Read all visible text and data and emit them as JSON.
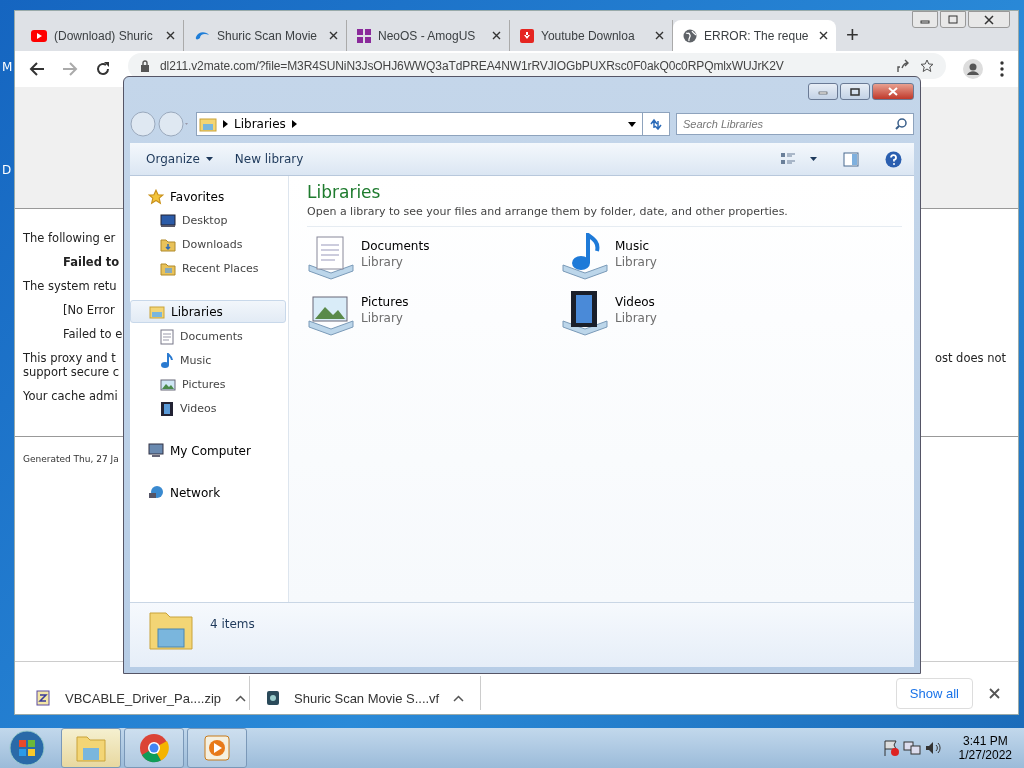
{
  "desktop": {
    "labels": [
      "M",
      "D"
    ]
  },
  "browser": {
    "tabs": [
      {
        "label": "(Download) Shuric",
        "selected": false
      },
      {
        "label": "Shuric Scan Movie",
        "selected": false
      },
      {
        "label": "NeoOS - AmogUS",
        "selected": false
      },
      {
        "label": "Youtube Downloa",
        "selected": false
      },
      {
        "label": "ERROR: The reque",
        "selected": true
      }
    ],
    "new_tab": "+",
    "address": "dl211.v2mate.com/?file=M3R4SUNiN3JsOHJ6WWQ3aTdPREA4NW1rRVJIOGbPUXRsc0F0akQ0c0RPQmlxWUJrK2V",
    "page": {
      "lines": [
        {
          "text": "The following er",
          "indent": false,
          "bold": false
        },
        {
          "text": "Failed to",
          "indent": true,
          "bold": true
        },
        {
          "text": "The system retu",
          "indent": false,
          "bold": false
        },
        {
          "text": "[No Error",
          "indent": true,
          "bold": false
        },
        {
          "text": "Failed to e",
          "indent": true,
          "bold": false
        },
        {
          "text": "This proxy and t",
          "continuation": "support secure c",
          "indent": false,
          "bold": false,
          "right": "ost does not"
        },
        {
          "text": "Your cache admi",
          "indent": false,
          "bold": false
        }
      ],
      "footer": "Generated Thu, 27 Ja"
    },
    "downloads": [
      {
        "name": "VBCABLE_Driver_Pa....zip"
      },
      {
        "name": "Shuric Scan Movie S....vf"
      }
    ],
    "show_all": "Show all"
  },
  "explorer": {
    "breadcrumb": "Libraries",
    "search_placeholder": "Search Libraries",
    "commands": [
      "Organize",
      "New library"
    ],
    "nav": [
      {
        "label": "Favorites",
        "selected": false,
        "children": [
          {
            "label": "Desktop",
            "selected": false
          },
          {
            "label": "Downloads",
            "selected": false
          },
          {
            "label": "Recent Places",
            "selected": false
          }
        ]
      },
      {
        "label": "Libraries",
        "selected": true,
        "children": [
          {
            "label": "Documents",
            "selected": false
          },
          {
            "label": "Music",
            "selected": false
          },
          {
            "label": "Pictures",
            "selected": false
          },
          {
            "label": "Videos",
            "selected": false
          }
        ]
      },
      {
        "label": "My Computer",
        "selected": false
      },
      {
        "label": "Network",
        "selected": false
      }
    ],
    "heading": "Libraries",
    "subheading": "Open a library to see your files and arrange them by folder, date, and other properties.",
    "libraries": [
      {
        "name": "Documents",
        "type": "Library"
      },
      {
        "name": "Music",
        "type": "Library"
      },
      {
        "name": "Pictures",
        "type": "Library"
      },
      {
        "name": "Videos",
        "type": "Library"
      }
    ],
    "details": "4 items"
  },
  "taskbar": {
    "apps": [
      {
        "selected": true
      },
      {
        "selected": false
      },
      {
        "selected": false
      }
    ],
    "time": "3:41 PM",
    "date": "1/27/2022"
  }
}
